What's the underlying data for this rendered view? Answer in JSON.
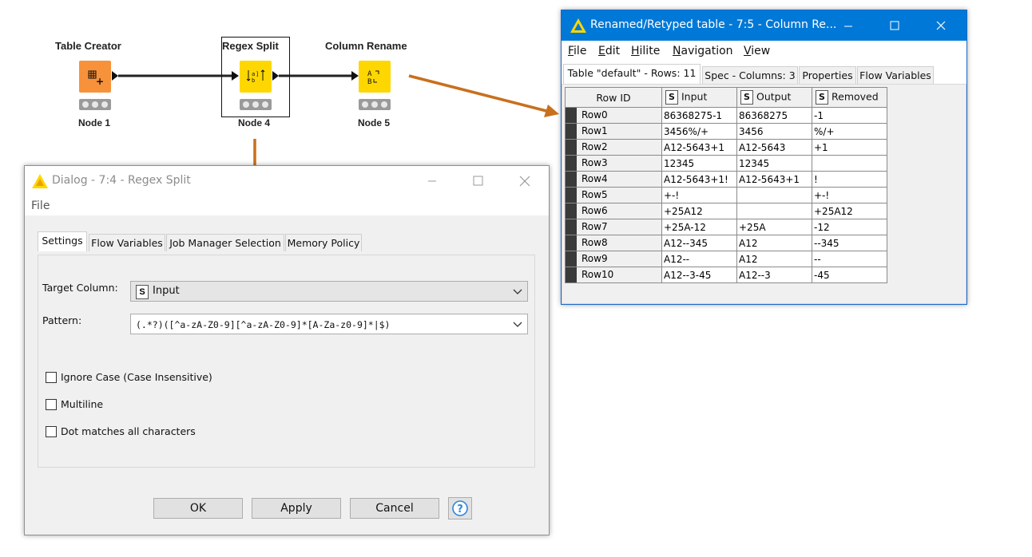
{
  "workflow": {
    "nodes": [
      {
        "title": "Table Creator",
        "label": "Node 1",
        "color": "#f7923b",
        "icon": "table-grid-icon"
      },
      {
        "title": "Regex Split",
        "label": "Node 4",
        "color": "#ffd700",
        "icon": "regex-split-icon"
      },
      {
        "title": "Column Rename",
        "label": "Node 5",
        "color": "#ffd700",
        "icon": "column-rename-icon"
      }
    ],
    "arrow_color": "#c8701d"
  },
  "table_window": {
    "title": "Renamed/Retyped table - 7:5 - Column Re...",
    "accent": "#0078d7",
    "menu": [
      {
        "mn": "F",
        "rest": "ile"
      },
      {
        "mn": "E",
        "rest": "dit"
      },
      {
        "mn": "H",
        "rest": "ilite"
      },
      {
        "mn": "N",
        "rest": "avigation"
      },
      {
        "mn": "V",
        "rest": "iew"
      }
    ],
    "tabs": [
      "Table \"default\" - Rows: 11",
      "Spec - Columns: 3",
      "Properties",
      "Flow Variables"
    ],
    "columns": {
      "rowid": "Row ID",
      "col1": "Input",
      "col2": "Output",
      "col3": "Removed",
      "type_badge": "S"
    },
    "rows": [
      {
        "id": "Row0",
        "input": "86368275-1",
        "output": "86368275",
        "removed": "-1"
      },
      {
        "id": "Row1",
        "input": "3456%/+",
        "output": "3456",
        "removed": "%/+"
      },
      {
        "id": "Row2",
        "input": "A12-5643+1",
        "output": "A12-5643",
        "removed": "+1"
      },
      {
        "id": "Row3",
        "input": "12345",
        "output": "12345",
        "removed": ""
      },
      {
        "id": "Row4",
        "input": "A12-5643+1!",
        "output": "A12-5643+1",
        "removed": "!"
      },
      {
        "id": "Row5",
        "input": "+-!",
        "output": "",
        "removed": "+-!"
      },
      {
        "id": "Row6",
        "input": "+25A12",
        "output": "",
        "removed": "+25A12"
      },
      {
        "id": "Row7",
        "input": "+25A-12",
        "output": "+25A",
        "removed": "-12"
      },
      {
        "id": "Row8",
        "input": "A12--345",
        "output": "A12",
        "removed": "--345"
      },
      {
        "id": "Row9",
        "input": "A12--",
        "output": "A12",
        "removed": "--"
      },
      {
        "id": "Row10",
        "input": "A12--3-45",
        "output": "A12--3",
        "removed": "-45"
      }
    ]
  },
  "dialog": {
    "title": "Dialog - 7:4 - Regex Split",
    "menu_file": "File",
    "tabs": [
      "Settings",
      "Flow Variables",
      "Job Manager Selection",
      "Memory Policy"
    ],
    "target_column_label": "Target Column:",
    "target_column_badge": "S",
    "target_column_value": "Input",
    "pattern_label": "Pattern:",
    "pattern_value": "(.*?)([^a-zA-Z0-9][^a-zA-Z0-9]*[A-Za-z0-9]*|$)",
    "checkboxes": [
      "Ignore Case (Case Insensitive)",
      "Multiline",
      "Dot matches all characters"
    ],
    "buttons": {
      "ok": "OK",
      "apply": "Apply",
      "cancel": "Cancel",
      "help": "?"
    }
  }
}
